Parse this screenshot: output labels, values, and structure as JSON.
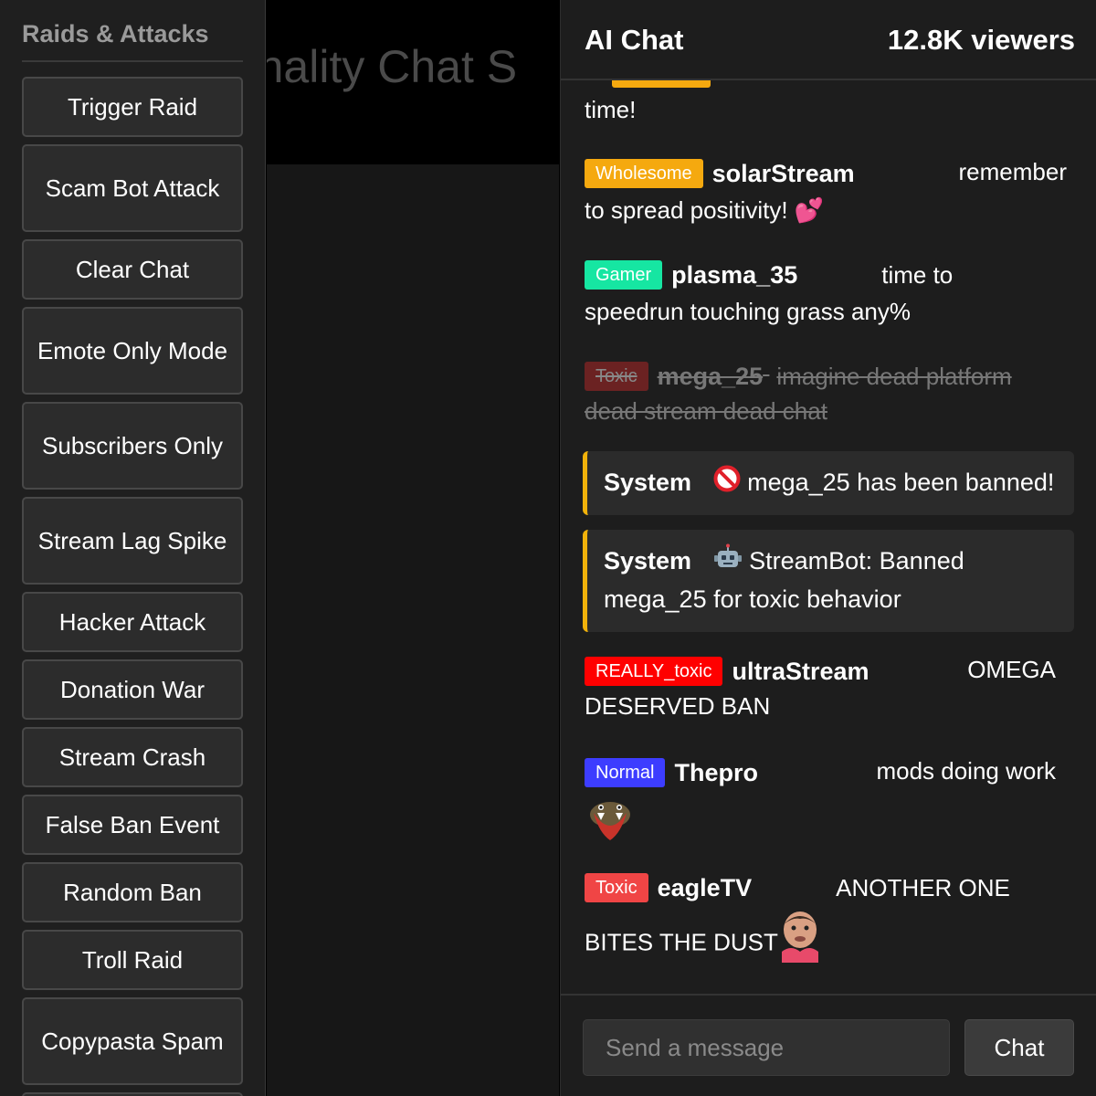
{
  "sidebar": {
    "title": "Raids & Attacks",
    "buttons": [
      "Trigger Raid",
      "Scam Bot Attack",
      "Clear Chat",
      "Emote Only Mode",
      "Subscribers Only",
      "Stream Lag Spike",
      "Hacker Attack",
      "Donation War",
      "Stream Crash",
      "False Ban Event",
      "Random Ban",
      "Troll Raid",
      "Copypasta Spam"
    ]
  },
  "center": {
    "title": "Personality Chat S"
  },
  "chat": {
    "title": "AI Chat",
    "viewers": "12.8K viewers",
    "partial_message": "time!",
    "messages": [
      {
        "badge": "Wholesome",
        "badge_color": "#f5a90f",
        "user": "solarStream",
        "text_line1": "remember",
        "text_line2": "to spread positivity! 💕"
      },
      {
        "badge": "Gamer",
        "badge_color": "#16e6a2",
        "user": "plasma_35",
        "text_line1": "time to",
        "text_line2": "speedrun touching grass any%"
      },
      {
        "badge": "Toxic",
        "badge_color": "#8b2a2a",
        "user": "mega_25",
        "text": "imagine dead platform",
        "text_line2": "dead stream dead chat",
        "deleted": true
      },
      {
        "badge": "REALLY_toxic",
        "badge_color": "#ff0000",
        "user": "ultraStream",
        "text_line1": "OMEGA",
        "text_line2": "DESERVED BAN"
      },
      {
        "badge": "Normal",
        "badge_color": "#3d3dff",
        "user": "Thepro",
        "text_line1": "mods doing work"
      },
      {
        "badge": "Toxic",
        "badge_color": "#f04545",
        "user": "eagleTV",
        "text_line1": "ANOTHER ONE",
        "text_line2": "BITES THE DUST"
      }
    ],
    "system_messages": [
      {
        "label": "System",
        "icon": "no-entry-icon",
        "text": "mega_25 has been banned!"
      },
      {
        "label": "System",
        "icon": "robot-icon",
        "text_line1": "StreamBot: Banned",
        "text_line2": "mega_25 for toxic behavior"
      }
    ],
    "input_placeholder": "Send a message",
    "send_label": "Chat"
  },
  "colors": {
    "system_accent": "#f1b20a",
    "sidebar_bg": "#1f1f1f",
    "chat_bg": "#1d1d1d"
  }
}
